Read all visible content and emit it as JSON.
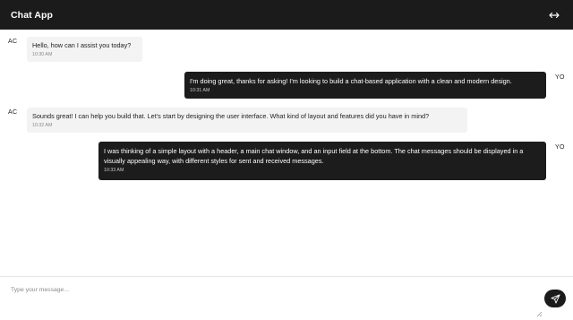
{
  "header": {
    "title": "Chat App",
    "expand_icon": "expand-horizontal-icon"
  },
  "messages": [
    {
      "sender": "AC",
      "direction": "received",
      "text": "Hello, how can I assist you today?",
      "time": "10:30 AM"
    },
    {
      "sender": "YO",
      "direction": "sent",
      "text": "I'm doing great, thanks for asking! I'm looking to build a chat-based application with a clean and modern design.",
      "time": "10:31 AM"
    },
    {
      "sender": "AC",
      "direction": "received",
      "text": "Sounds great! I can help you build that. Let's start by designing the user interface. What kind of layout and features did you have in mind?",
      "time": "10:32 AM"
    },
    {
      "sender": "YO",
      "direction": "sent",
      "text": "I was thinking of a simple layout with a header, a main chat window, and an input field at the bottom. The chat messages should be displayed in a visually appealing way, with different styles for sent and received messages.",
      "time": "10:33 AM"
    }
  ],
  "composer": {
    "placeholder": "Type your message...",
    "value": "",
    "send_icon": "send-icon"
  },
  "colors": {
    "header_bg": "#1b1b1b",
    "sent_bubble": "#1c1c1c",
    "received_bubble": "#f3f3f3"
  }
}
